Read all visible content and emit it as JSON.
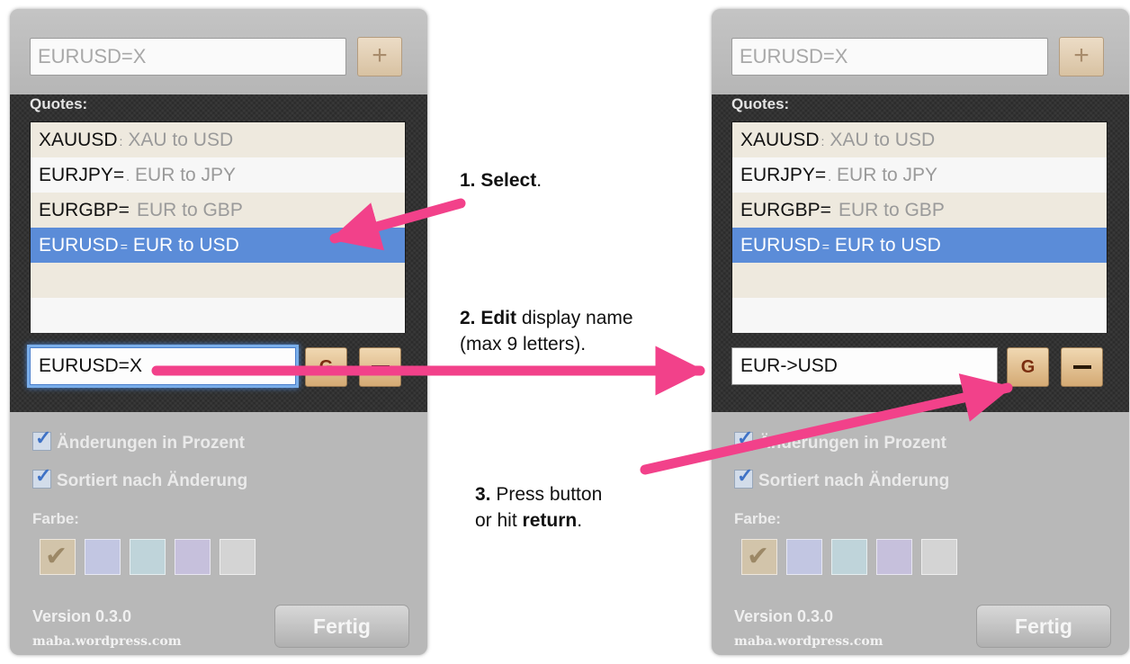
{
  "panels": [
    {
      "id": "before",
      "symbol_input": {
        "value": "EURUSD=X"
      },
      "add_button": {
        "label": "+"
      },
      "quotes_label": "Quotes:",
      "quotes": [
        {
          "symbol": "XAUUSD",
          "sep": ":",
          "desc": "XAU to USD",
          "selected": false
        },
        {
          "symbol": "EURJPY=",
          "sep": ".",
          "desc": "EUR to JPY",
          "selected": false
        },
        {
          "symbol": "EURGBP=",
          "sep": "",
          "desc": "EUR to GBP",
          "selected": false
        },
        {
          "symbol": "EURUSD",
          "sep": "=",
          "desc": "EUR to USD",
          "selected": true
        }
      ],
      "name_input": {
        "value": "EURUSD=X",
        "focused": true
      },
      "rename_button": {
        "icon": "rename-g-icon",
        "glyph": "G"
      },
      "remove_button": {
        "icon": "minus-icon"
      },
      "checkboxes": [
        {
          "label": "Änderungen in Prozent",
          "checked": true
        },
        {
          "label": "Sortiert nach Änderung",
          "checked": true
        }
      ],
      "color_label": "Farbe:",
      "swatches": [
        "#d2c4aa",
        "#c2c6e2",
        "#bfd4da",
        "#c6c0dc",
        "#d4d4d4"
      ],
      "version": "Version 0.3.0",
      "site": "maba.wordpress.com",
      "done_button": "Fertig"
    },
    {
      "id": "after",
      "symbol_input": {
        "value": "EURUSD=X"
      },
      "add_button": {
        "label": "+"
      },
      "quotes_label": "Quotes:",
      "quotes": [
        {
          "symbol": "XAUUSD",
          "sep": ":",
          "desc": "XAU to USD",
          "selected": false
        },
        {
          "symbol": "EURJPY=",
          "sep": ".",
          "desc": "EUR to JPY",
          "selected": false
        },
        {
          "symbol": "EURGBP=",
          "sep": "",
          "desc": "EUR to GBP",
          "selected": false
        },
        {
          "symbol": "EURUSD",
          "sep": "=",
          "desc": "EUR to USD",
          "selected": true
        }
      ],
      "name_input": {
        "value": "EUR->USD",
        "focused": false
      },
      "rename_button": {
        "icon": "rename-g-icon",
        "glyph": "G"
      },
      "remove_button": {
        "icon": "minus-icon"
      },
      "checkboxes": [
        {
          "label": "Änderungen in Prozent",
          "checked": true
        },
        {
          "label": "Sortiert nach Änderung",
          "checked": true
        }
      ],
      "color_label": "Farbe:",
      "swatches": [
        "#d2c4aa",
        "#c2c6e2",
        "#bfd4da",
        "#c6c0dc",
        "#d4d4d4"
      ],
      "version": "Version 0.3.0",
      "site": "maba.wordpress.com",
      "done_button": "Fertig"
    }
  ],
  "annotations": {
    "step1": {
      "bold": "1. Select",
      "rest": "."
    },
    "step2": {
      "bold": "2. Edit",
      "rest": " display name",
      "line2": "(max 9 letters)."
    },
    "step3": {
      "bold_num": "3.",
      "rest": " Press button",
      "line2_pre": "or hit ",
      "line2_bold": "return",
      "line2_post": "."
    }
  },
  "colors": {
    "arrow": "#f2418a",
    "selection": "#5b8cd8",
    "focus_ring": "#4a86d8"
  }
}
